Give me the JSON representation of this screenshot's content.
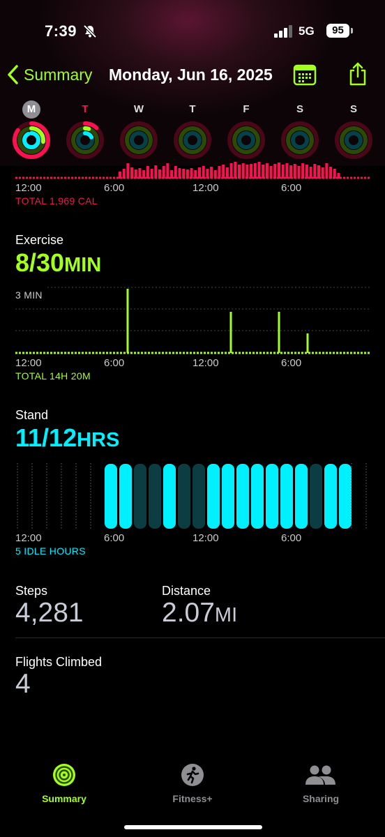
{
  "status": {
    "time": "7:39",
    "network": "5G",
    "battery": "95"
  },
  "nav": {
    "back_label": "Summary",
    "title": "Monday, Jun 16, 2025"
  },
  "week": [
    {
      "day": "M",
      "selected": true,
      "move": 0.85,
      "exercise": 0.27,
      "stand": 0.92
    },
    {
      "day": "T",
      "today": true,
      "move": 0.12,
      "exercise": 0.05,
      "stand": 0.18
    },
    {
      "day": "W",
      "move": 0,
      "exercise": 0,
      "stand": 0
    },
    {
      "day": "T",
      "move": 0,
      "exercise": 0,
      "stand": 0
    },
    {
      "day": "F",
      "move": 0,
      "exercise": 0,
      "stand": 0
    },
    {
      "day": "S",
      "move": 0,
      "exercise": 0,
      "stand": 0
    },
    {
      "day": "S",
      "move": 0,
      "exercise": 0,
      "stand": 0
    }
  ],
  "move": {
    "total": "TOTAL 1,969 CAL",
    "ticks": [
      "12:00",
      "6:00",
      "12:00",
      "6:00"
    ]
  },
  "exercise": {
    "label": "Exercise",
    "value": "8/30",
    "unit": "MIN",
    "ymax": "3 MIN",
    "ticks": [
      "12:00",
      "6:00",
      "12:00",
      "6:00"
    ],
    "total": "TOTAL 14H 20M"
  },
  "stand": {
    "label": "Stand",
    "value": "11/12",
    "unit": "HRS",
    "ticks": [
      "12:00",
      "6:00",
      "12:00",
      "6:00"
    ],
    "idle": "5 IDLE HOURS"
  },
  "steps": {
    "label": "Steps",
    "value": "4,281"
  },
  "distance": {
    "label": "Distance",
    "value": "2.07",
    "unit": "MI"
  },
  "flights": {
    "label": "Flights Climbed",
    "value": "4"
  },
  "tabs": [
    {
      "label": "Summary",
      "active": true
    },
    {
      "label": "Fitness+"
    },
    {
      "label": "Sharing"
    }
  ],
  "colors": {
    "move": "#fa114f",
    "exercise": "#a4ff1f",
    "stand": "#00f0ff",
    "accent": "#a4ff1f"
  }
}
